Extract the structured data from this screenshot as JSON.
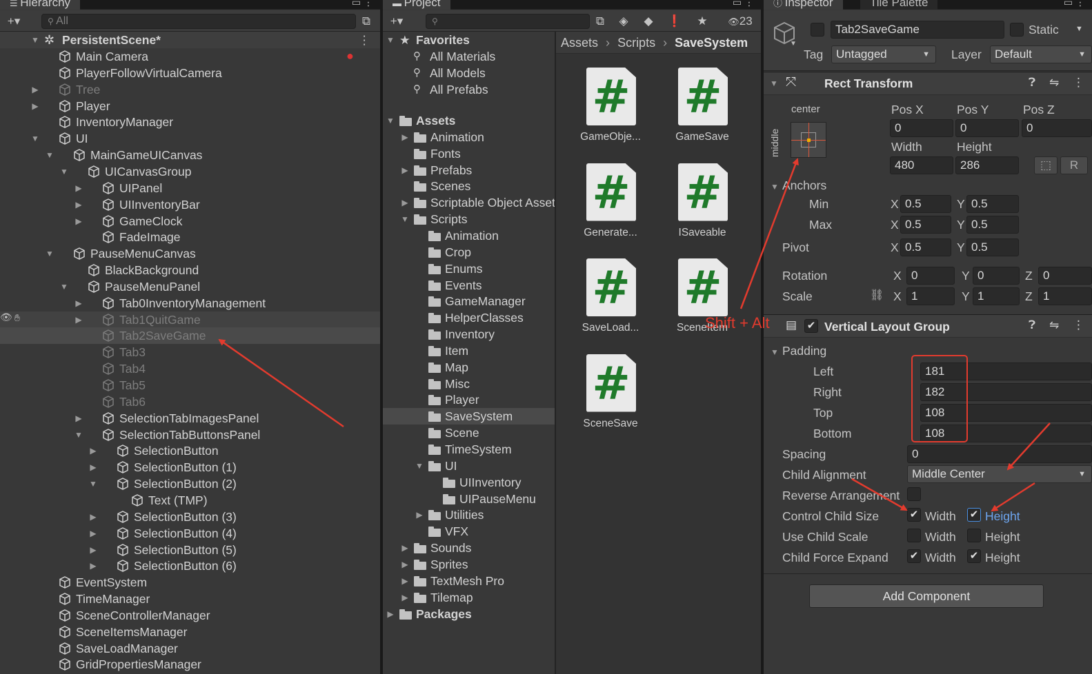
{
  "hierarchy": {
    "tab": "Hierarchy",
    "search_placeholder": "All",
    "scene": "PersistentScene*",
    "items": [
      {
        "label": "Main Camera",
        "indent": 0,
        "arrow": "",
        "state": ""
      },
      {
        "label": "PlayerFollowVirtualCamera",
        "indent": 0,
        "arrow": "",
        "state": ""
      },
      {
        "label": "Tree",
        "indent": 0,
        "arrow": "right",
        "state": "dim"
      },
      {
        "label": "Player",
        "indent": 0,
        "arrow": "right",
        "state": ""
      },
      {
        "label": "InventoryManager",
        "indent": 0,
        "arrow": "",
        "state": ""
      },
      {
        "label": "UI",
        "indent": 0,
        "arrow": "down",
        "state": ""
      },
      {
        "label": "MainGameUICanvas",
        "indent": 1,
        "arrow": "down",
        "state": ""
      },
      {
        "label": "UICanvasGroup",
        "indent": 2,
        "arrow": "down",
        "state": ""
      },
      {
        "label": "UIPanel",
        "indent": 3,
        "arrow": "right",
        "state": ""
      },
      {
        "label": "UIInventoryBar",
        "indent": 3,
        "arrow": "right",
        "state": ""
      },
      {
        "label": "GameClock",
        "indent": 3,
        "arrow": "right",
        "state": ""
      },
      {
        "label": "FadeImage",
        "indent": 3,
        "arrow": "",
        "state": ""
      },
      {
        "label": "PauseMenuCanvas",
        "indent": 1,
        "arrow": "down",
        "state": ""
      },
      {
        "label": "BlackBackground",
        "indent": 2,
        "arrow": "",
        "state": ""
      },
      {
        "label": "PauseMenuPanel",
        "indent": 2,
        "arrow": "down",
        "state": ""
      },
      {
        "label": "Tab0InventoryManagement",
        "indent": 3,
        "arrow": "right",
        "state": ""
      },
      {
        "label": "Tab1QuitGame",
        "indent": 3,
        "arrow": "right",
        "state": "dim hl"
      },
      {
        "label": "Tab2SaveGame",
        "indent": 3,
        "arrow": "",
        "state": "dim sel"
      },
      {
        "label": "Tab3",
        "indent": 3,
        "arrow": "",
        "state": "dim"
      },
      {
        "label": "Tab4",
        "indent": 3,
        "arrow": "",
        "state": "dim"
      },
      {
        "label": "Tab5",
        "indent": 3,
        "arrow": "",
        "state": "dim"
      },
      {
        "label": "Tab6",
        "indent": 3,
        "arrow": "",
        "state": "dim"
      },
      {
        "label": "SelectionTabImagesPanel",
        "indent": 3,
        "arrow": "right",
        "state": ""
      },
      {
        "label": "SelectionTabButtonsPanel",
        "indent": 3,
        "arrow": "down",
        "state": ""
      },
      {
        "label": "SelectionButton",
        "indent": 4,
        "arrow": "right",
        "state": ""
      },
      {
        "label": "SelectionButton (1)",
        "indent": 4,
        "arrow": "right",
        "state": ""
      },
      {
        "label": "SelectionButton (2)",
        "indent": 4,
        "arrow": "down",
        "state": ""
      },
      {
        "label": "Text (TMP)",
        "indent": 5,
        "arrow": "",
        "state": ""
      },
      {
        "label": "SelectionButton (3)",
        "indent": 4,
        "arrow": "right",
        "state": ""
      },
      {
        "label": "SelectionButton (4)",
        "indent": 4,
        "arrow": "right",
        "state": ""
      },
      {
        "label": "SelectionButton (5)",
        "indent": 4,
        "arrow": "right",
        "state": ""
      },
      {
        "label": "SelectionButton (6)",
        "indent": 4,
        "arrow": "right",
        "state": ""
      },
      {
        "label": "EventSystem",
        "indent": 0,
        "arrow": "",
        "state": ""
      },
      {
        "label": "TimeManager",
        "indent": 0,
        "arrow": "",
        "state": ""
      },
      {
        "label": "SceneControllerManager",
        "indent": 0,
        "arrow": "",
        "state": ""
      },
      {
        "label": "SceneItemsManager",
        "indent": 0,
        "arrow": "",
        "state": ""
      },
      {
        "label": "SaveLoadManager",
        "indent": 0,
        "arrow": "",
        "state": ""
      },
      {
        "label": "GridPropertiesManager",
        "indent": 0,
        "arrow": "",
        "state": ""
      }
    ]
  },
  "project": {
    "tab": "Project",
    "hidden_count": "23",
    "favorites_label": "Favorites",
    "favorites": [
      "All Materials",
      "All Models",
      "All Prefabs"
    ],
    "tree": [
      {
        "label": "Assets",
        "indent": 0,
        "arrow": "down",
        "bold": true,
        "open": true
      },
      {
        "label": "Animation",
        "indent": 1,
        "arrow": "right"
      },
      {
        "label": "Fonts",
        "indent": 1,
        "arrow": ""
      },
      {
        "label": "Prefabs",
        "indent": 1,
        "arrow": "right"
      },
      {
        "label": "Scenes",
        "indent": 1,
        "arrow": ""
      },
      {
        "label": "Scriptable Object Assets",
        "indent": 1,
        "arrow": "right"
      },
      {
        "label": "Scripts",
        "indent": 1,
        "arrow": "down",
        "open": true
      },
      {
        "label": "Animation",
        "indent": 2,
        "arrow": ""
      },
      {
        "label": "Crop",
        "indent": 2,
        "arrow": ""
      },
      {
        "label": "Enums",
        "indent": 2,
        "arrow": ""
      },
      {
        "label": "Events",
        "indent": 2,
        "arrow": ""
      },
      {
        "label": "GameManager",
        "indent": 2,
        "arrow": ""
      },
      {
        "label": "HelperClasses",
        "indent": 2,
        "arrow": ""
      },
      {
        "label": "Inventory",
        "indent": 2,
        "arrow": ""
      },
      {
        "label": "Item",
        "indent": 2,
        "arrow": ""
      },
      {
        "label": "Map",
        "indent": 2,
        "arrow": ""
      },
      {
        "label": "Misc",
        "indent": 2,
        "arrow": ""
      },
      {
        "label": "Player",
        "indent": 2,
        "arrow": ""
      },
      {
        "label": "SaveSystem",
        "indent": 2,
        "arrow": "",
        "sel": true
      },
      {
        "label": "Scene",
        "indent": 2,
        "arrow": ""
      },
      {
        "label": "TimeSystem",
        "indent": 2,
        "arrow": ""
      },
      {
        "label": "UI",
        "indent": 2,
        "arrow": "down",
        "open": true
      },
      {
        "label": "UIInventory",
        "indent": 3,
        "arrow": ""
      },
      {
        "label": "UIPauseMenu",
        "indent": 3,
        "arrow": ""
      },
      {
        "label": "Utilities",
        "indent": 2,
        "arrow": "right"
      },
      {
        "label": "VFX",
        "indent": 2,
        "arrow": ""
      },
      {
        "label": "Sounds",
        "indent": 1,
        "arrow": "right"
      },
      {
        "label": "Sprites",
        "indent": 1,
        "arrow": "right"
      },
      {
        "label": "TextMesh Pro",
        "indent": 1,
        "arrow": "right"
      },
      {
        "label": "Tilemap",
        "indent": 1,
        "arrow": "right"
      },
      {
        "label": "Packages",
        "indent": 0,
        "arrow": "right",
        "bold": true
      }
    ],
    "breadcrumb": [
      "Assets",
      "Scripts",
      "SaveSystem"
    ],
    "assets": [
      "GameObje...",
      "GameSave",
      "Generate...",
      "ISaveable",
      "SaveLoad...",
      "SceneItem",
      "SceneSave"
    ],
    "asset_glyph": "#"
  },
  "inspector": {
    "tab": "Inspector",
    "tab2": "Tile Palette",
    "object_name": "Tab2SaveGame",
    "static_label": "Static",
    "tag_label": "Tag",
    "tag_value": "Untagged",
    "layer_label": "Layer",
    "layer_value": "Default",
    "rect": {
      "title": "Rect Transform",
      "anchor_h": "center",
      "anchor_v": "middle",
      "posx_label": "Pos X",
      "posy_label": "Pos Y",
      "posz_label": "Pos Z",
      "posx": "0",
      "posy": "0",
      "posz": "0",
      "width_label": "Width",
      "height_label": "Height",
      "width": "480",
      "height": "286",
      "r_btn": "R",
      "anchors_label": "Anchors",
      "min_label": "Min",
      "max_label": "Max",
      "pivot_label": "Pivot",
      "x": "X",
      "y": "Y",
      "z": "Z",
      "min_x": "0.5",
      "min_y": "0.5",
      "max_x": "0.5",
      "max_y": "0.5",
      "pivot_x": "0.5",
      "pivot_y": "0.5",
      "rotation_label": "Rotation",
      "rot_x": "0",
      "rot_y": "0",
      "rot_z": "0",
      "scale_label": "Scale",
      "scale_x": "1",
      "scale_y": "1",
      "scale_z": "1"
    },
    "vlg": {
      "title": "Vertical Layout Group",
      "padding_label": "Padding",
      "left_label": "Left",
      "left": "181",
      "right_label": "Right",
      "right": "182",
      "top_label": "Top",
      "top": "108",
      "bottom_label": "Bottom",
      "bottom": "108",
      "spacing_label": "Spacing",
      "spacing": "0",
      "child_alignment_label": "Child Alignment",
      "child_alignment": "Middle Center",
      "reverse_label": "Reverse Arrangement",
      "control_label": "Control Child Size",
      "use_scale_label": "Use Child Scale",
      "force_expand_label": "Child Force Expand",
      "width_label": "Width",
      "height_label": "Height"
    },
    "add_component": "Add Component"
  },
  "annotation": {
    "text": "Shift + Alt",
    "color": "#e33b2e"
  }
}
